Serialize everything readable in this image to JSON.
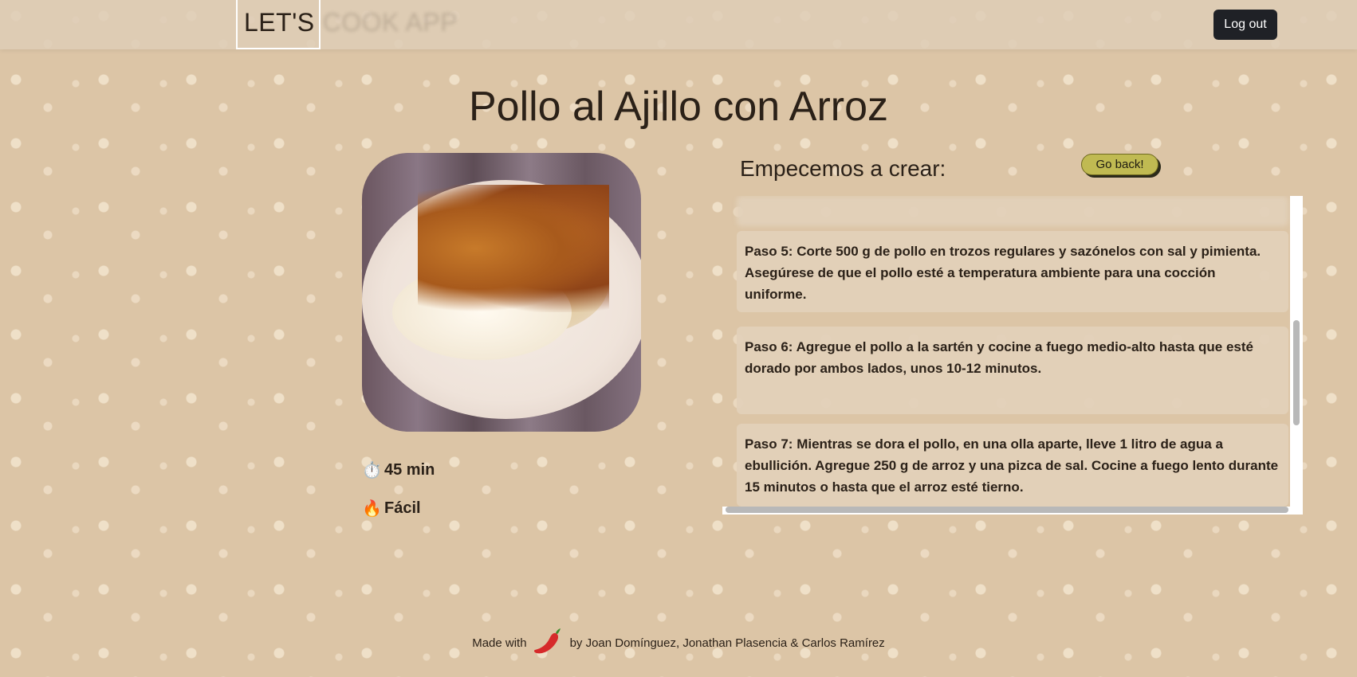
{
  "header": {
    "logo_main": "LET'S",
    "logo_faded": "COOK APP",
    "logout_label": "Log out"
  },
  "recipe": {
    "title": "Pollo al Ajillo con Arroz",
    "time": "45 min",
    "time_icon": "⏱️",
    "difficulty": "Fácil",
    "difficulty_icon": "🔥"
  },
  "steps_panel": {
    "heading": "Empecemos a crear:",
    "go_back_label": "Go back!",
    "steps": [
      "Paso 5: Corte 500 g de pollo en trozos regulares y sazónelos con sal y pimienta. Asegúrese de que el pollo esté a temperatura ambiente para una cocción uniforme.",
      "Paso 6: Agregue el pollo a la sartén y cocine a fuego medio-alto hasta que esté dorado por ambos lados, unos 10-12 minutos.",
      "Paso 7: Mientras se dora el pollo, en una olla aparte, lleve 1 litro de agua a ebullición. Agregue 250 g de arroz y una pizca de sal. Cocine a fuego lento durante 15 minutos o hasta que el arroz esté tierno."
    ]
  },
  "footer": {
    "made_with": "Made with",
    "by_text": "by Joan Domínguez, Jonathan Plasencia & Carlos Ramírez"
  },
  "colors": {
    "background": "#dcc5a6",
    "logout_bg": "#1f2126",
    "goback_bg": "#c0ba52",
    "pepper": "#d62a2a"
  }
}
